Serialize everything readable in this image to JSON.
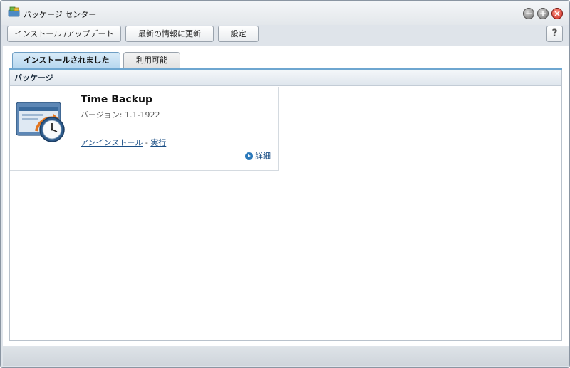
{
  "window": {
    "title": "パッケージ センター",
    "controls": {
      "minimize": "−",
      "maximize": "+",
      "close": "×"
    }
  },
  "toolbar": {
    "install_update_label": "インストール /アップデート",
    "refresh_label": "最新の情報に更新",
    "settings_label": "設定",
    "help_label": "?"
  },
  "tabs": [
    {
      "label": "インストールされました",
      "active": true
    },
    {
      "label": "利用可能",
      "active": false
    }
  ],
  "panel": {
    "header": "パッケージ"
  },
  "packages": [
    {
      "name": "Time Backup",
      "version": "バージョン: 1.1-1922",
      "uninstall_label": "アンインストール",
      "separator": " - ",
      "run_label": "実行",
      "details_label": "詳細"
    }
  ],
  "colors": {
    "accent": "#6ea6d0",
    "link": "#1b4f86",
    "close_button": "#c8221a"
  }
}
